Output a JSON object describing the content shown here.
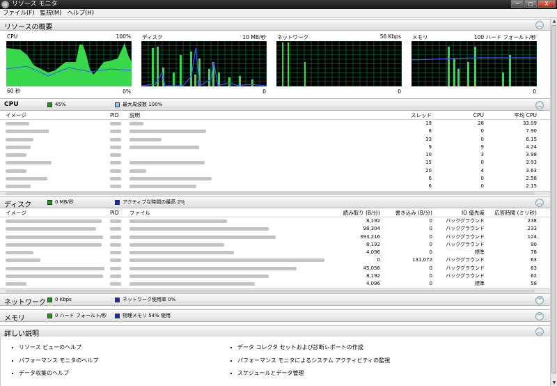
{
  "window": {
    "title": "リソース モニタ",
    "min": "─",
    "max": "□",
    "close": "X"
  },
  "menu": [
    "ファイル(F)",
    "監視(M)",
    "ヘルプ(H)"
  ],
  "overview": {
    "title": "リソースの概要",
    "collapse_icon": "chevron-up-icon",
    "graphs": [
      {
        "label": "CPU",
        "max": "100%",
        "bottom_left": "60 秒",
        "bottom_right": "0%"
      },
      {
        "label": "ディスク",
        "max": "10 MB/秒",
        "bottom_left": "",
        "bottom_right": "0"
      },
      {
        "label": "ネットワーク",
        "max": "56 Kbps",
        "bottom_left": "",
        "bottom_right": "0"
      },
      {
        "label": "メモリ",
        "max": "100 ハード フォールト/秒",
        "bottom_left": "",
        "bottom_right": "0"
      }
    ]
  },
  "cpu": {
    "title": "CPU",
    "usage": "45%",
    "freq": "最大周波数 100%",
    "columns": [
      "イメージ",
      "PID",
      "説明",
      "スレッド",
      "CPU",
      "平均 CPU"
    ],
    "rows": [
      {
        "threads": "19",
        "cpu": "28",
        "avg": "33.09"
      },
      {
        "threads": "8",
        "cpu": "0",
        "avg": "7.90"
      },
      {
        "threads": "33",
        "cpu": "0",
        "avg": "6.15"
      },
      {
        "threads": "9",
        "cpu": "9",
        "avg": "4.24"
      },
      {
        "threads": "10",
        "cpu": "3",
        "avg": "3.98"
      },
      {
        "threads": "15",
        "cpu": "0",
        "avg": "3.93"
      },
      {
        "threads": "20",
        "cpu": "4",
        "avg": "3.63"
      },
      {
        "threads": "6",
        "cpu": "0",
        "avg": "2.58"
      },
      {
        "threads": "6",
        "cpu": "0",
        "avg": "2.15"
      }
    ]
  },
  "disk": {
    "title": "ディスク",
    "rate": "0 MB/秒",
    "active": "アクティブな時間の最高 2%",
    "columns": [
      "イメージ",
      "PID",
      "ファイル",
      "読み取り (B/分)",
      "書き込み (B/分)",
      "IO 優先度",
      "応答時間 (ミリ秒)"
    ],
    "rows": [
      {
        "read": "8,192",
        "write": "0",
        "prio": "バックグラウンド",
        "resp": "238"
      },
      {
        "read": "98,304",
        "write": "0",
        "prio": "バックグラウンド",
        "resp": "233"
      },
      {
        "read": "393,216",
        "write": "0",
        "prio": "バックグラウンド",
        "resp": "124"
      },
      {
        "read": "8,192",
        "write": "0",
        "prio": "バックグラウンド",
        "resp": "90"
      },
      {
        "read": "4,096",
        "write": "0",
        "prio": "標準",
        "resp": "78"
      },
      {
        "read": "0",
        "write": "131,072",
        "prio": "バックグラウンド",
        "resp": "63"
      },
      {
        "read": "45,056",
        "write": "0",
        "prio": "バックグラウンド",
        "resp": "63"
      },
      {
        "read": "8,192",
        "write": "0",
        "prio": "バックグラウンド",
        "resp": "62"
      },
      {
        "read": "4,096",
        "write": "0",
        "prio": "標準",
        "resp": "58"
      }
    ]
  },
  "network": {
    "title": "ネットワーク",
    "rate": "0 Kbps",
    "usage": "ネットワーク使用率 0%"
  },
  "memory": {
    "title": "メモリ",
    "faults": "0 ハード フォールト/秒",
    "usage": "物理メモリ 54% 使用"
  },
  "help": {
    "title": "詳しい説明",
    "links": [
      "リソース ビューのヘルプ",
      "パフォーマンス モニタのヘルプ",
      "データ収集のヘルプ",
      "データ コレクタ セットおよび診断レポートの作成",
      "パフォーマンス モニタによるシステム アクティビティの監視",
      "スケジュールとデータ管理"
    ]
  },
  "colors": {
    "graph_bg": "#000000",
    "grid": "#008c46",
    "series_green": "#37d84a",
    "series_blue": "#3f56ff"
  },
  "icons": {
    "expand": "chevron-down-icon",
    "collapse": "chevron-up-icon"
  }
}
